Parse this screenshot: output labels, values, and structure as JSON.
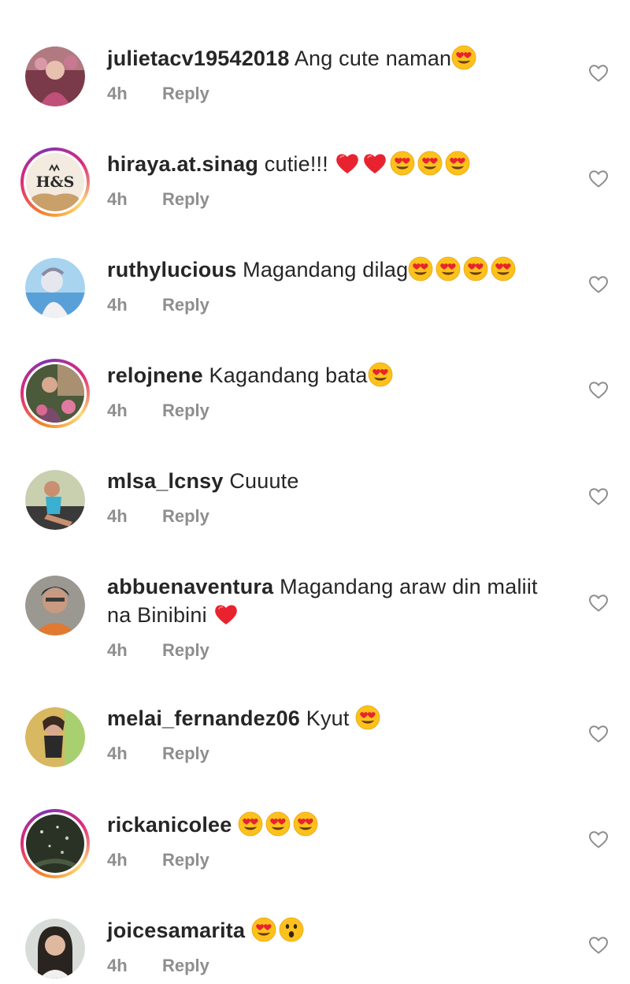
{
  "comments": [
    {
      "username": "julietacv19542018",
      "text": "Ang cute naman",
      "emojis": [
        "heart-eyes"
      ],
      "time": "4h",
      "reply": "Reply"
    },
    {
      "username": "hiraya.at.sinag",
      "text": "cutie!!!",
      "emojis": [
        "red-heart",
        "red-heart",
        "heart-eyes",
        "heart-eyes",
        "heart-eyes"
      ],
      "time": "4h",
      "reply": "Reply",
      "avatar_text": "H&S"
    },
    {
      "username": "ruthylucious",
      "text": "Magandang dilag",
      "emojis": [
        "heart-eyes",
        "heart-eyes",
        "heart-eyes",
        "heart-eyes"
      ],
      "time": "4h",
      "reply": "Reply"
    },
    {
      "username": "relojnene",
      "text": "Kagandang bata",
      "emojis": [
        "heart-eyes"
      ],
      "time": "4h",
      "reply": "Reply"
    },
    {
      "username": "mlsa_lcnsy",
      "text": "Cuuute",
      "emojis": [],
      "time": "4h",
      "reply": "Reply"
    },
    {
      "username": "abbuenaventura",
      "text": "Magandang araw din maliit",
      "text_line2": "na Binibini",
      "emojis": [
        "red-heart"
      ],
      "time": "4h",
      "reply": "Reply"
    },
    {
      "username": "melai_fernandez06",
      "text": "Kyut",
      "emojis": [
        "heart-eyes"
      ],
      "time": "4h",
      "reply": "Reply"
    },
    {
      "username": "rickanicolee",
      "text": "",
      "emojis": [
        "heart-eyes",
        "heart-eyes",
        "heart-eyes"
      ],
      "time": "4h",
      "reply": "Reply"
    },
    {
      "username": "joicesamarita",
      "text": "",
      "emojis": [
        "heart-eyes",
        "astonished"
      ],
      "time": "4h",
      "reply": "Reply"
    }
  ],
  "colors": {
    "text": "#262626",
    "meta": "#8e8e8e",
    "story_ring": "#dd2a7b",
    "emoji_face": "#ffcc33",
    "emoji_heart": "#e8232f"
  }
}
